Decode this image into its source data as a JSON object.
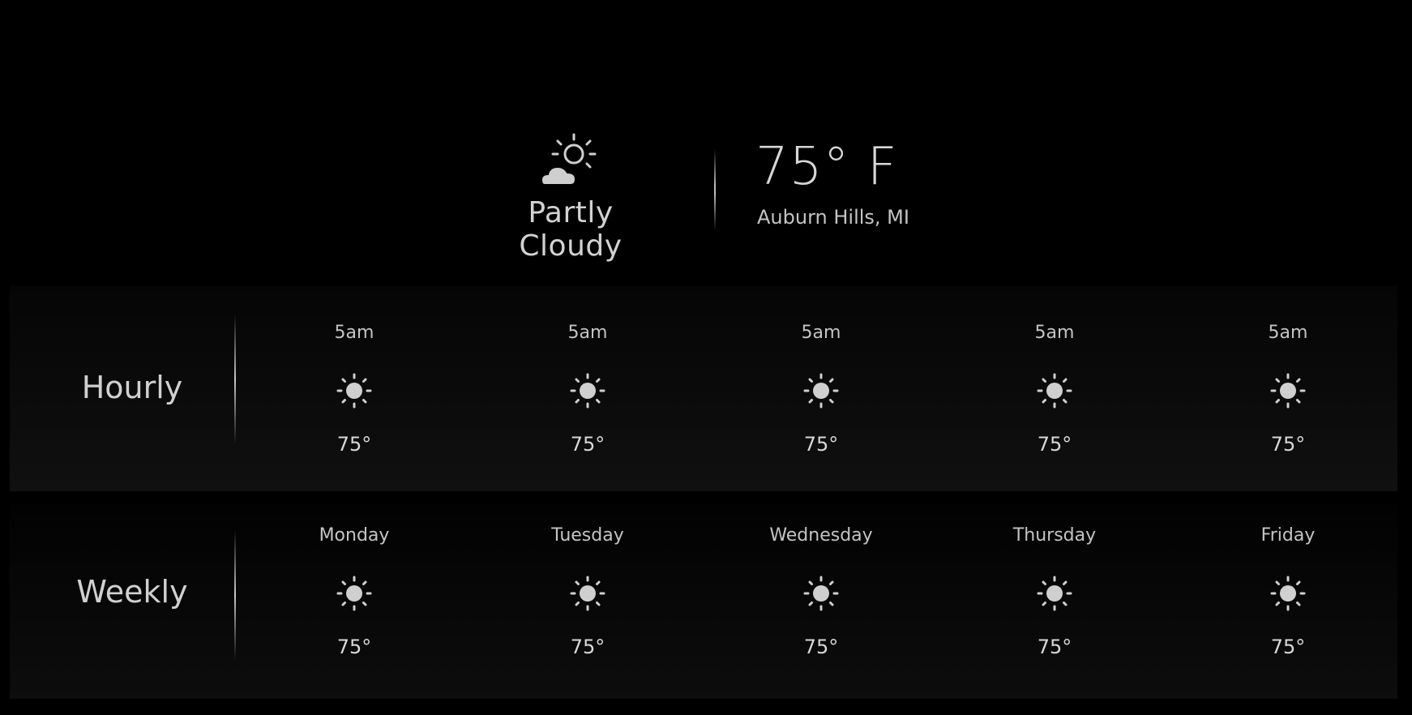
{
  "current": {
    "condition": "Partly Cloudy",
    "condition_icon": "partly-cloudy-icon",
    "temperature": "75° F",
    "location": "Auburn Hills, MI"
  },
  "hourly": {
    "label": "Hourly",
    "items": [
      {
        "time": "5am",
        "icon": "sun-icon",
        "temp": "75°"
      },
      {
        "time": "5am",
        "icon": "sun-icon",
        "temp": "75°"
      },
      {
        "time": "5am",
        "icon": "sun-icon",
        "temp": "75°"
      },
      {
        "time": "5am",
        "icon": "sun-icon",
        "temp": "75°"
      },
      {
        "time": "5am",
        "icon": "sun-icon",
        "temp": "75°"
      }
    ]
  },
  "weekly": {
    "label": "Weekly",
    "items": [
      {
        "day": "Monday",
        "icon": "sun-icon",
        "temp": "75°"
      },
      {
        "day": "Tuesday",
        "icon": "sun-icon",
        "temp": "75°"
      },
      {
        "day": "Wednesday",
        "icon": "sun-icon",
        "temp": "75°"
      },
      {
        "day": "Thursday",
        "icon": "sun-icon",
        "temp": "75°"
      },
      {
        "day": "Friday",
        "icon": "sun-icon",
        "temp": "75°"
      }
    ]
  },
  "colors": {
    "background": "#000000",
    "text": "#c9c9c9",
    "icon": "#cfcfcf"
  }
}
